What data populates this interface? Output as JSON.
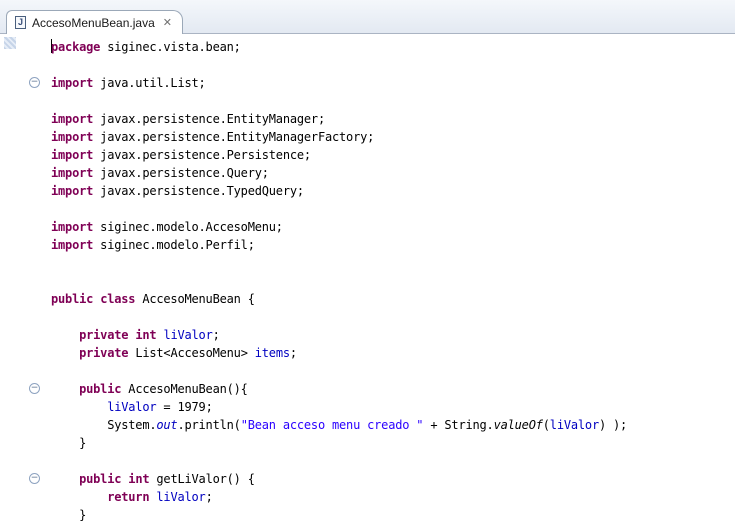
{
  "tab": {
    "title": "AccesoMenuBean.java",
    "file_icon_letter": "J",
    "close_glyph": "✕"
  },
  "code": {
    "lines": [
      [
        {
          "t": "package",
          "k": "kw"
        },
        {
          "t": " siginec.vista.bean;"
        }
      ],
      [],
      [
        {
          "t": "import",
          "k": "kw"
        },
        {
          "t": " java.util.List;"
        }
      ],
      [],
      [
        {
          "t": "import",
          "k": "kw"
        },
        {
          "t": " javax.persistence.EntityManager;"
        }
      ],
      [
        {
          "t": "import",
          "k": "kw"
        },
        {
          "t": " javax.persistence.EntityManagerFactory;"
        }
      ],
      [
        {
          "t": "import",
          "k": "kw"
        },
        {
          "t": " javax.persistence.Persistence;"
        }
      ],
      [
        {
          "t": "import",
          "k": "kw"
        },
        {
          "t": " javax.persistence.Query;"
        }
      ],
      [
        {
          "t": "import",
          "k": "kw"
        },
        {
          "t": " javax.persistence.TypedQuery;"
        }
      ],
      [],
      [
        {
          "t": "import",
          "k": "kw"
        },
        {
          "t": " siginec.modelo.AccesoMenu;"
        }
      ],
      [
        {
          "t": "import",
          "k": "kw"
        },
        {
          "t": " siginec.modelo.Perfil;"
        }
      ],
      [],
      [],
      [
        {
          "t": "public",
          "k": "kw"
        },
        {
          "t": " "
        },
        {
          "t": "class",
          "k": "kw"
        },
        {
          "t": " AccesoMenuBean {"
        }
      ],
      [],
      [
        {
          "t": "    "
        },
        {
          "t": "private",
          "k": "kw"
        },
        {
          "t": " "
        },
        {
          "t": "int",
          "k": "kw"
        },
        {
          "t": " "
        },
        {
          "t": "liValor",
          "k": "field"
        },
        {
          "t": ";"
        }
      ],
      [
        {
          "t": "    "
        },
        {
          "t": "private",
          "k": "kw"
        },
        {
          "t": " List<AccesoMenu> "
        },
        {
          "t": "items",
          "k": "field"
        },
        {
          "t": ";"
        }
      ],
      [],
      [
        {
          "t": "    "
        },
        {
          "t": "public",
          "k": "kw"
        },
        {
          "t": " AccesoMenuBean(){"
        }
      ],
      [
        {
          "t": "        "
        },
        {
          "t": "liValor",
          "k": "field"
        },
        {
          "t": " = 1979;"
        }
      ],
      [
        {
          "t": "        System."
        },
        {
          "t": "out",
          "k": "fld-ital"
        },
        {
          "t": ".println("
        },
        {
          "t": "\"Bean acceso menu creado \"",
          "k": "str"
        },
        {
          "t": " + String."
        },
        {
          "t": "valueOf",
          "k": "ital"
        },
        {
          "t": "("
        },
        {
          "t": "liValor",
          "k": "field"
        },
        {
          "t": ") );"
        }
      ],
      [
        {
          "t": "    }"
        }
      ],
      [],
      [
        {
          "t": "    "
        },
        {
          "t": "public",
          "k": "kw"
        },
        {
          "t": " "
        },
        {
          "t": "int",
          "k": "kw"
        },
        {
          "t": " getLiValor() {"
        }
      ],
      [
        {
          "t": "        "
        },
        {
          "t": "return",
          "k": "kw"
        },
        {
          "t": " "
        },
        {
          "t": "liValor",
          "k": "field"
        },
        {
          "t": ";"
        }
      ],
      [
        {
          "t": "    }"
        }
      ]
    ],
    "fold_lines": [
      2,
      19,
      24
    ],
    "fold_glyph": "⊖",
    "colors": {
      "keyword": "#7f0055",
      "field": "#0000c0",
      "string": "#2a00ff",
      "default": "#000000"
    }
  }
}
